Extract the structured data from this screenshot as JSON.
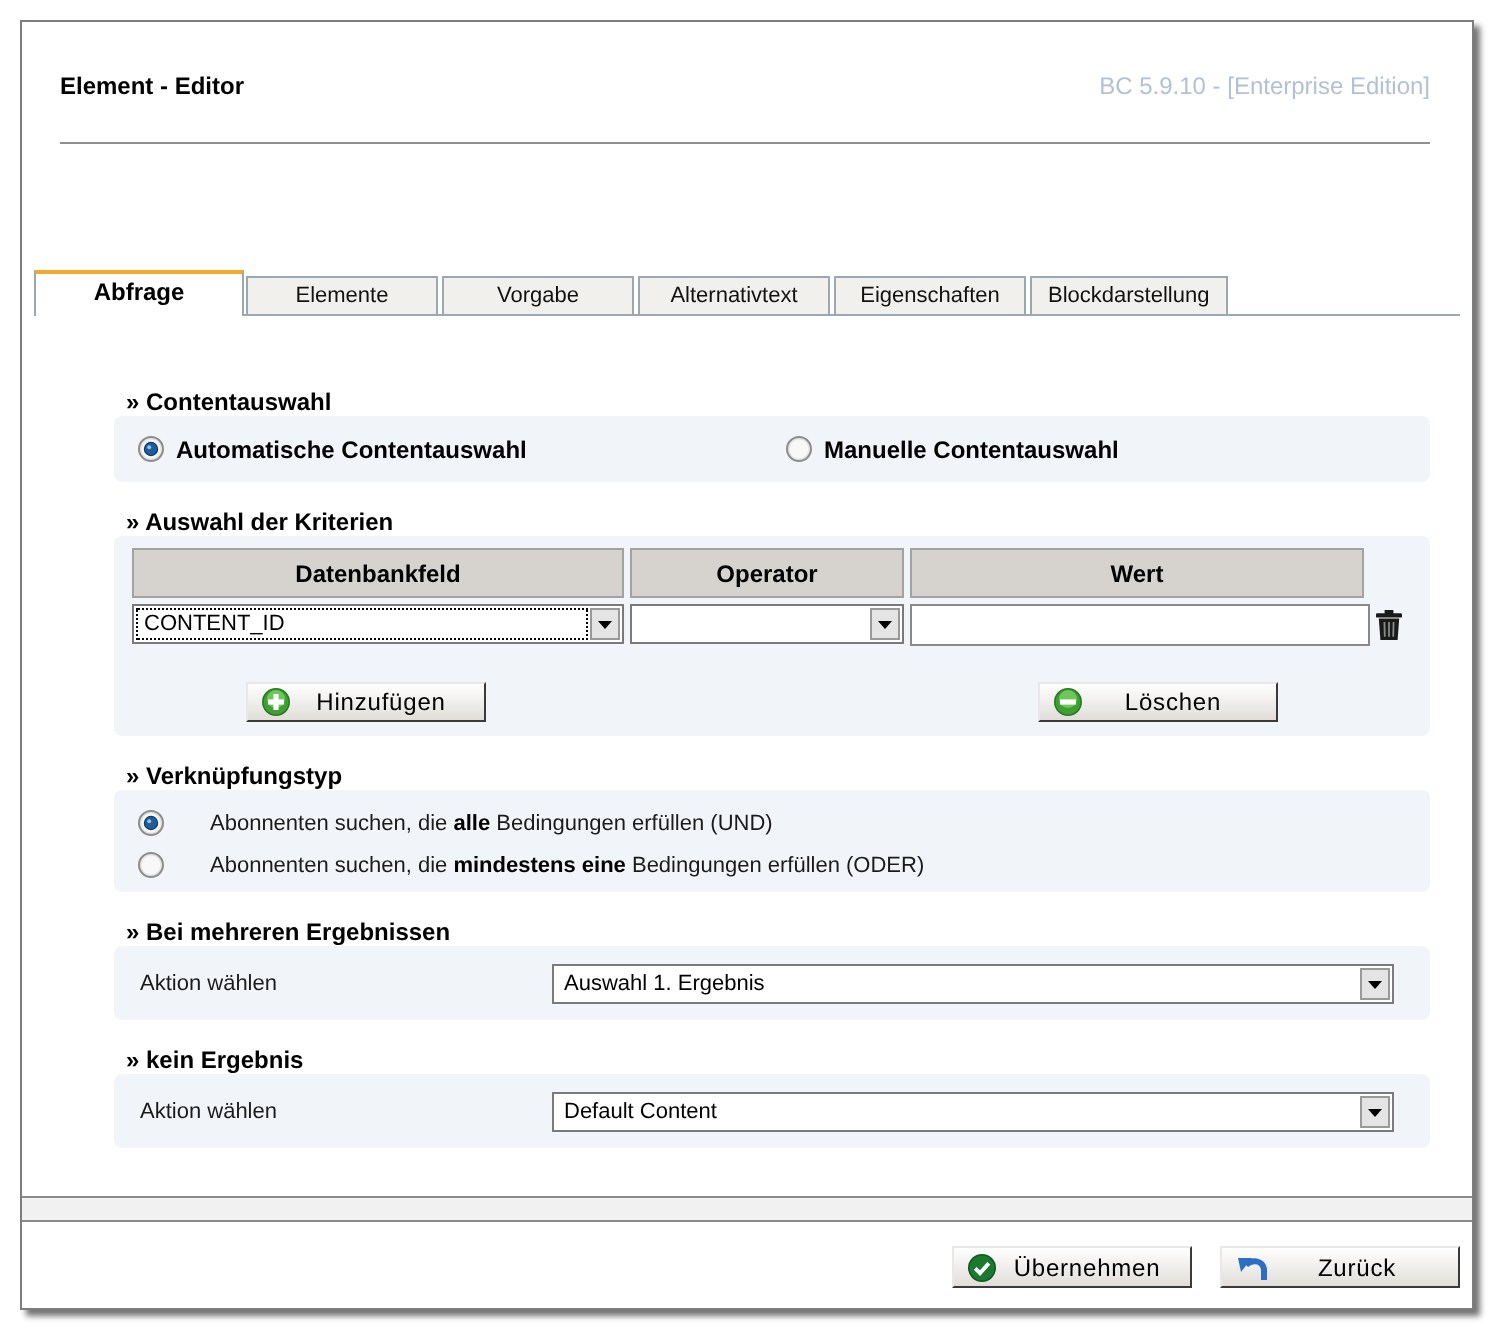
{
  "window": {
    "title": "Element - Editor",
    "version": "BC 5.9.10 - [Enterprise Edition]"
  },
  "tabs": [
    {
      "label": "Abfrage",
      "selected": true
    },
    {
      "label": "Elemente",
      "selected": false
    },
    {
      "label": "Vorgabe",
      "selected": false
    },
    {
      "label": "Alternativtext",
      "selected": false
    },
    {
      "label": "Eigenschaften",
      "selected": false
    },
    {
      "label": "Blockdarstellung",
      "selected": false
    }
  ],
  "sections": [
    {
      "kind": "radio-row",
      "heading": "» Contentauswahl",
      "options": [
        {
          "label": "Automatische Contentauswahl",
          "selected": true
        },
        {
          "label": "Manuelle Contentauswahl",
          "selected": false
        }
      ]
    },
    {
      "kind": "table",
      "heading": "» Auswahl der Kriterien",
      "columns": [
        "Datenbankfeld",
        "Operator",
        "Wert"
      ],
      "rows": [
        {
          "field": "CONTENT_ID",
          "focused": true
        }
      ],
      "buttons": [
        {
          "kind": "add",
          "label": "Hinzufügen"
        },
        {
          "kind": "remove",
          "label": "Löschen"
        }
      ]
    },
    {
      "kind": "radio-list",
      "heading": "» Verknüpfungstyp",
      "options": [
        {
          "label": "Abonnenten suchen, die **alle** Bedingungen erfüllen (UND)",
          "selected": true
        },
        {
          "label": "Abonnenten suchen, die **mindestens eine** Bedingungen erfüllen (ODER)",
          "selected": false
        }
      ]
    },
    {
      "kind": "select",
      "heading": "» Bei mehreren Ergebnissen",
      "label": "Aktion wählen",
      "value": "Auswahl 1. Ergebnis"
    },
    {
      "kind": "select",
      "heading": "» kein Ergebnis",
      "label": "Aktion wählen",
      "value": "Default Content"
    }
  ],
  "footer_buttons": [
    {
      "kind": "apply",
      "label": "Übernehmen"
    },
    {
      "kind": "back",
      "label": "Zurück"
    }
  ]
}
